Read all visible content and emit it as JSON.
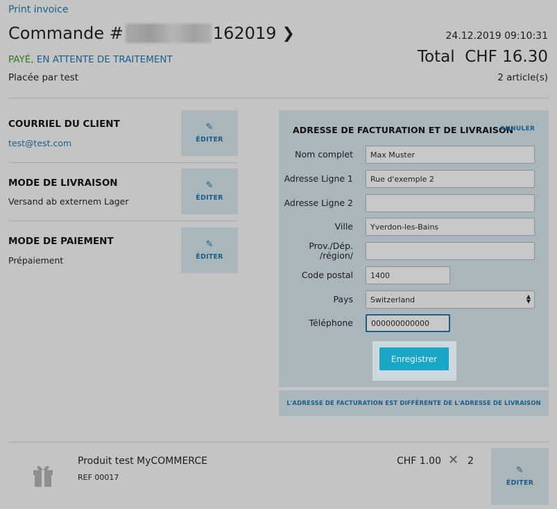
{
  "header": {
    "print_label": "Print invoice",
    "order_prefix": "Commande #",
    "order_suffix": "162019",
    "date": "24.12.2019 09:10:31",
    "status_paid": "PAYÉ,",
    "status_pending": "EN ATTENTE DE TRAITEMENT",
    "total_label": "Total",
    "total_value": "CHF 16.30",
    "placed_by": "Placée par test",
    "item_count": "2 article(s)"
  },
  "sections": {
    "email": {
      "label": "COURRIEL DU CLIENT",
      "value": "test@test.com",
      "edit": "ÉDITER"
    },
    "delivery": {
      "label": "MODE DE LIVRAISON",
      "value": "Versand ab externem Lager",
      "edit": "ÉDITER"
    },
    "payment": {
      "label": "MODE DE PAIEMENT",
      "value": "Prépaiement",
      "edit": "ÉDITER"
    }
  },
  "address_form": {
    "title": "ADRESSE DE FACTURATION ET DE LIVRAISON",
    "cancel": "ANNULER",
    "full_name": {
      "label": "Nom complet",
      "value": "Max Muster"
    },
    "address1": {
      "label": "Adresse Ligne 1",
      "value": "Rue d'exemple 2"
    },
    "address2": {
      "label": "Adresse Ligne 2",
      "value": ""
    },
    "city": {
      "label": "Ville",
      "value": "Yverdon-les-Bains"
    },
    "region": {
      "label": "Prov./Dép. /région/",
      "value": ""
    },
    "postal": {
      "label": "Code postal",
      "value": "1400"
    },
    "country": {
      "label": "Pays",
      "value": "Switzerland"
    },
    "phone": {
      "label": "Téléphone",
      "value": "000000000000"
    },
    "save": "Enregistrer",
    "different_address": "L'ADRESSE DE FACTURATION EST DIFFÉRENTE DE L'ADRESSE DE LIVRAISON"
  },
  "product": {
    "name": "Produit test MyCOMMERCE",
    "ref": "REF  00017",
    "price": "CHF 1.00",
    "times": "✕",
    "qty": "2",
    "edit": "ÉDITER"
  },
  "icons": {
    "pencil": "✎",
    "chevron": "❯",
    "gift": "gift-icon"
  }
}
